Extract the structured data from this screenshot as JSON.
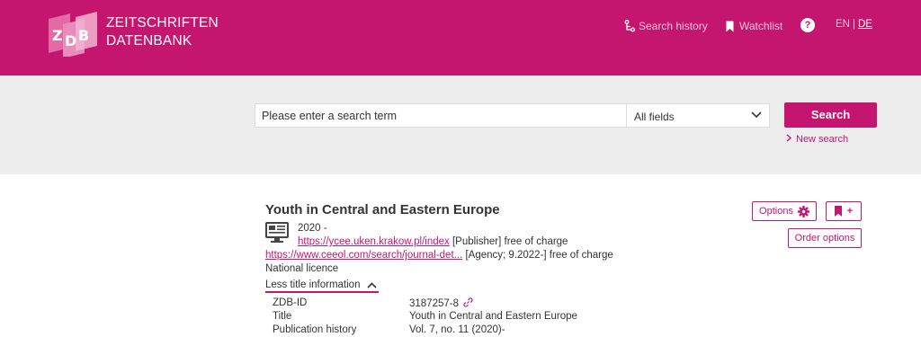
{
  "header": {
    "brand_line1": "ZEITSCHRIFTEN",
    "brand_line2": "DATENBANK",
    "search_history": "Search history",
    "watchlist": "Watchlist",
    "help": "?",
    "lang_en": "EN",
    "lang_sep": "|",
    "lang_de": "DE",
    "brand_color": "#c5166f"
  },
  "search": {
    "placeholder": "Please enter a search term",
    "field": "All fields",
    "button": "Search",
    "new_search": "New search"
  },
  "result": {
    "title": "Youth in Central and Eastern Europe",
    "years": "2020 -",
    "url1": "https://ycee.uken.krakow.pl/index",
    "url1_note": "[Publisher] free of charge",
    "url2": "https://www.ceeol.com/search/journal-det...",
    "url2_note": "[Agency; 9.2022-] free of charge",
    "licence": "National licence",
    "less_info": "Less title information",
    "options": "Options",
    "watch_plus": "+",
    "order_options": "Order options",
    "meta": [
      {
        "label": "ZDB-ID",
        "value": "3187257-8"
      },
      {
        "label": "Title",
        "value": "Youth in Central and Eastern Europe"
      },
      {
        "label": "Publication history",
        "value": "Vol. 7, no. 11 (2020)-"
      }
    ]
  }
}
